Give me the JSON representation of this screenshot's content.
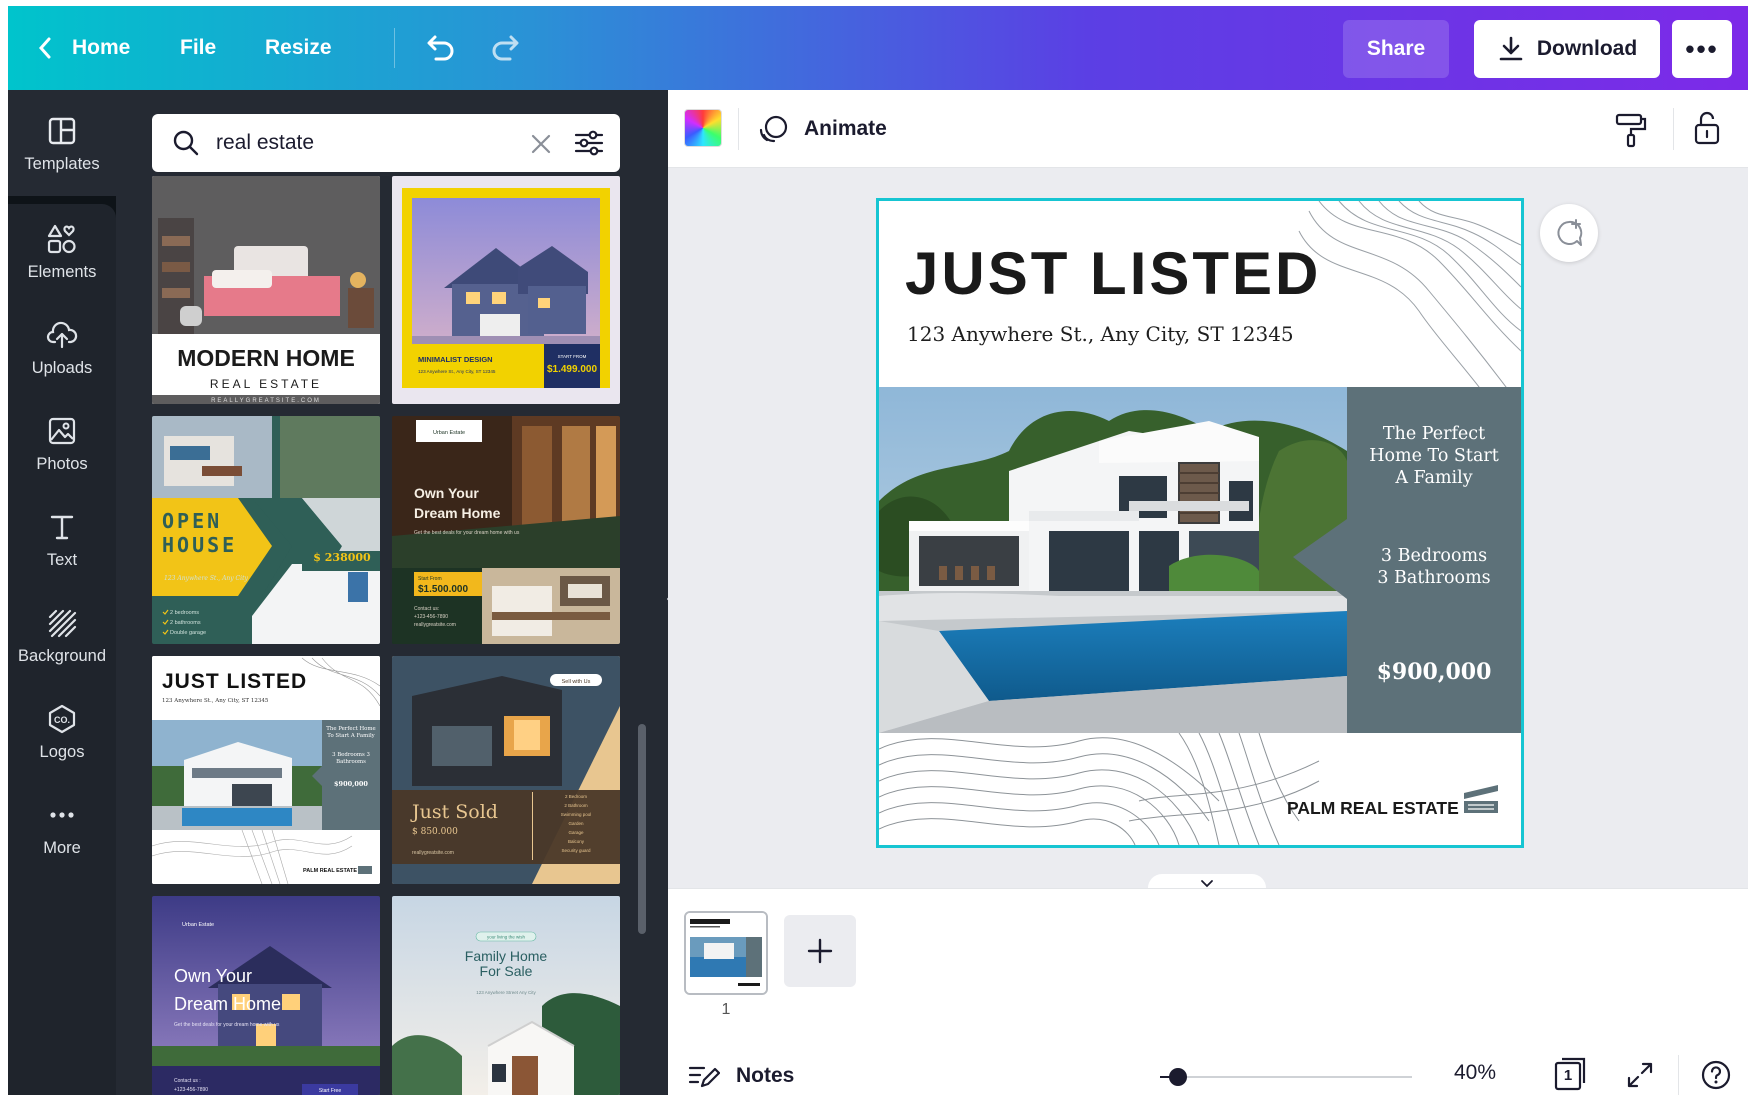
{
  "topbar": {
    "home_label": "Home",
    "file_label": "File",
    "resize_label": "Resize",
    "share_label": "Share",
    "download_label": "Download",
    "more_label": "•••"
  },
  "rail": {
    "items": [
      {
        "label": "Templates",
        "icon": "templates-icon"
      },
      {
        "label": "Elements",
        "icon": "elements-icon"
      },
      {
        "label": "Uploads",
        "icon": "upload-cloud-icon"
      },
      {
        "label": "Photos",
        "icon": "photo-icon"
      },
      {
        "label": "Text",
        "icon": "text-icon"
      },
      {
        "label": "Background",
        "icon": "background-icon"
      },
      {
        "label": "Logos",
        "icon": "logo-icon"
      },
      {
        "label": "More",
        "icon": "more-icon"
      }
    ]
  },
  "search": {
    "value": "real estate"
  },
  "templates": {
    "t1": {
      "title": "MODERN HOME",
      "subtitle": "REAL ESTATE",
      "footer": "REALLYGREATSITE.COM"
    },
    "t2": {
      "title": "MINIMALIST DESIGN",
      "address": "123 Anywhere St., Any City, ST 12345",
      "price_label": "START FROM",
      "price": "$1.499.000"
    },
    "t3": {
      "line1": "OPEN",
      "line2": "HOUSE",
      "price": "$ 238000",
      "address": "123 Anywhere St., Any City",
      "features": [
        "2 bedrooms",
        "2 bathrooms",
        "Double garage"
      ]
    },
    "t4": {
      "brand": "Urban Estate",
      "line1": "Own Your",
      "line2": "Dream Home",
      "body": "Get the best deals for your dream home with us",
      "price_label": "Start From",
      "price": "$1.500.000",
      "contact_label": "Contact us:",
      "phone": "+123-456-7890",
      "site": "reallygreatsite.com"
    },
    "t5": {
      "title": "JUST LISTED",
      "address": "123 Anywhere St., Any City, ST 12345",
      "blurb": "The Perfect Home To Start A Family",
      "rooms": "3 Bedrooms 3 Bathrooms",
      "price": "$900,000",
      "brand": "PALM REAL ESTATE"
    },
    "t6": {
      "badge": "Sell with Us",
      "title": "Just Sold",
      "price": "$ 850.000",
      "site": "reallygreatsite.com",
      "features": [
        "2 Bedroom",
        "2 Bathroom",
        "Swimming pool",
        "Garden",
        "Garage",
        "Balcony",
        "Security guard"
      ]
    },
    "t7": {
      "brand": "Urban Estate",
      "line1": "Own Your",
      "line2": "Dream Home",
      "body": "Get the best deals for your dream home with us",
      "contact_label": "Contact us :",
      "phone": "+123-456-7890",
      "cta": "Start Free"
    },
    "t8": {
      "badge": "your living the wish",
      "line1": "Family Home",
      "line2": "For Sale",
      "address": "123 Anywhere Street Any City"
    }
  },
  "editor": {
    "animate_label": "Animate",
    "design": {
      "title": "JUST LISTED",
      "address": "123 Anywhere St., Any City, ST 12345",
      "blurb_lines": [
        "The Perfect",
        "Home To Start",
        "A Family"
      ],
      "rooms_lines": [
        "3 Bedrooms",
        "3 Bathrooms"
      ],
      "price": "$900,000",
      "brand": "PALM REAL ESTATE"
    }
  },
  "footer": {
    "page_number": "1",
    "notes_label": "Notes",
    "zoom_label": "40%",
    "zoom_fraction": 0.04,
    "pages_count": "1"
  },
  "colors": {
    "accent_teal": "#00c4cc",
    "accent_purple": "#7d2ae8",
    "panel_bg": "#252a33",
    "rail_bg": "#1f242c",
    "design_slate": "#5d7179",
    "selection": "#16c5d2"
  }
}
